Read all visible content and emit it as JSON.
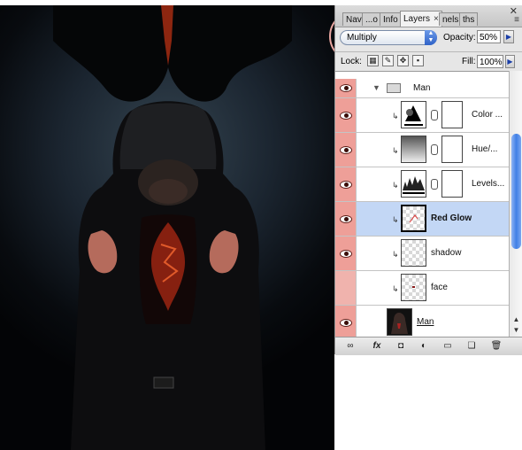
{
  "artwork": {
    "description_icon": "hooded-figure-red-glow-artwork"
  },
  "tabs": [
    {
      "label": "Nav"
    },
    {
      "label": "...o"
    },
    {
      "label": "Info"
    },
    {
      "label": "Layers",
      "active": true,
      "close": "×"
    },
    {
      "label": "nels"
    },
    {
      "label": "ths"
    }
  ],
  "window": {
    "close_glyph": "✕",
    "menu_glyph": "≡"
  },
  "blend": {
    "mode": "Multiply",
    "opacity_label": "Opacity:",
    "opacity_value": "50%"
  },
  "lock": {
    "label": "Lock:",
    "fill_label": "Fill:",
    "fill_value": "100%"
  },
  "layers": [
    {
      "name": "Man",
      "kind": "group",
      "visible": true
    },
    {
      "name": "Color ...",
      "kind": "adjustment",
      "thumb_icon": "color-balance-icon",
      "visible": true
    },
    {
      "name": "Hue/...",
      "kind": "adjustment",
      "thumb_icon": "hue-saturation-icon",
      "visible": true
    },
    {
      "name": "Levels...",
      "kind": "adjustment",
      "thumb_icon": "levels-histogram-icon",
      "visible": true
    },
    {
      "name": "Red Glow",
      "kind": "pixel",
      "selected": true,
      "visible": true
    },
    {
      "name": "shadow",
      "kind": "pixel",
      "visible": true
    },
    {
      "name": "face",
      "kind": "pixel",
      "visible": false
    },
    {
      "name": "Man",
      "kind": "smart",
      "visible": true
    }
  ],
  "bottom_bar": [
    {
      "name": "link-layers-icon",
      "glyph": "∞"
    },
    {
      "name": "fx-icon",
      "glyph": "fx"
    },
    {
      "name": "add-mask-icon",
      "glyph": "◘"
    },
    {
      "name": "adjustment-layer-icon",
      "glyph": "◐"
    },
    {
      "name": "new-group-icon",
      "glyph": "▭"
    },
    {
      "name": "new-layer-icon",
      "glyph": "❏"
    },
    {
      "name": "trash-icon",
      "glyph": "🗑"
    }
  ],
  "colors": {
    "visibility_column": "#ee9f98",
    "selected_row": "#c3d7f5",
    "scroll_thumb": "#3f7fe6",
    "highlight_circle": "#e9a6a0"
  }
}
